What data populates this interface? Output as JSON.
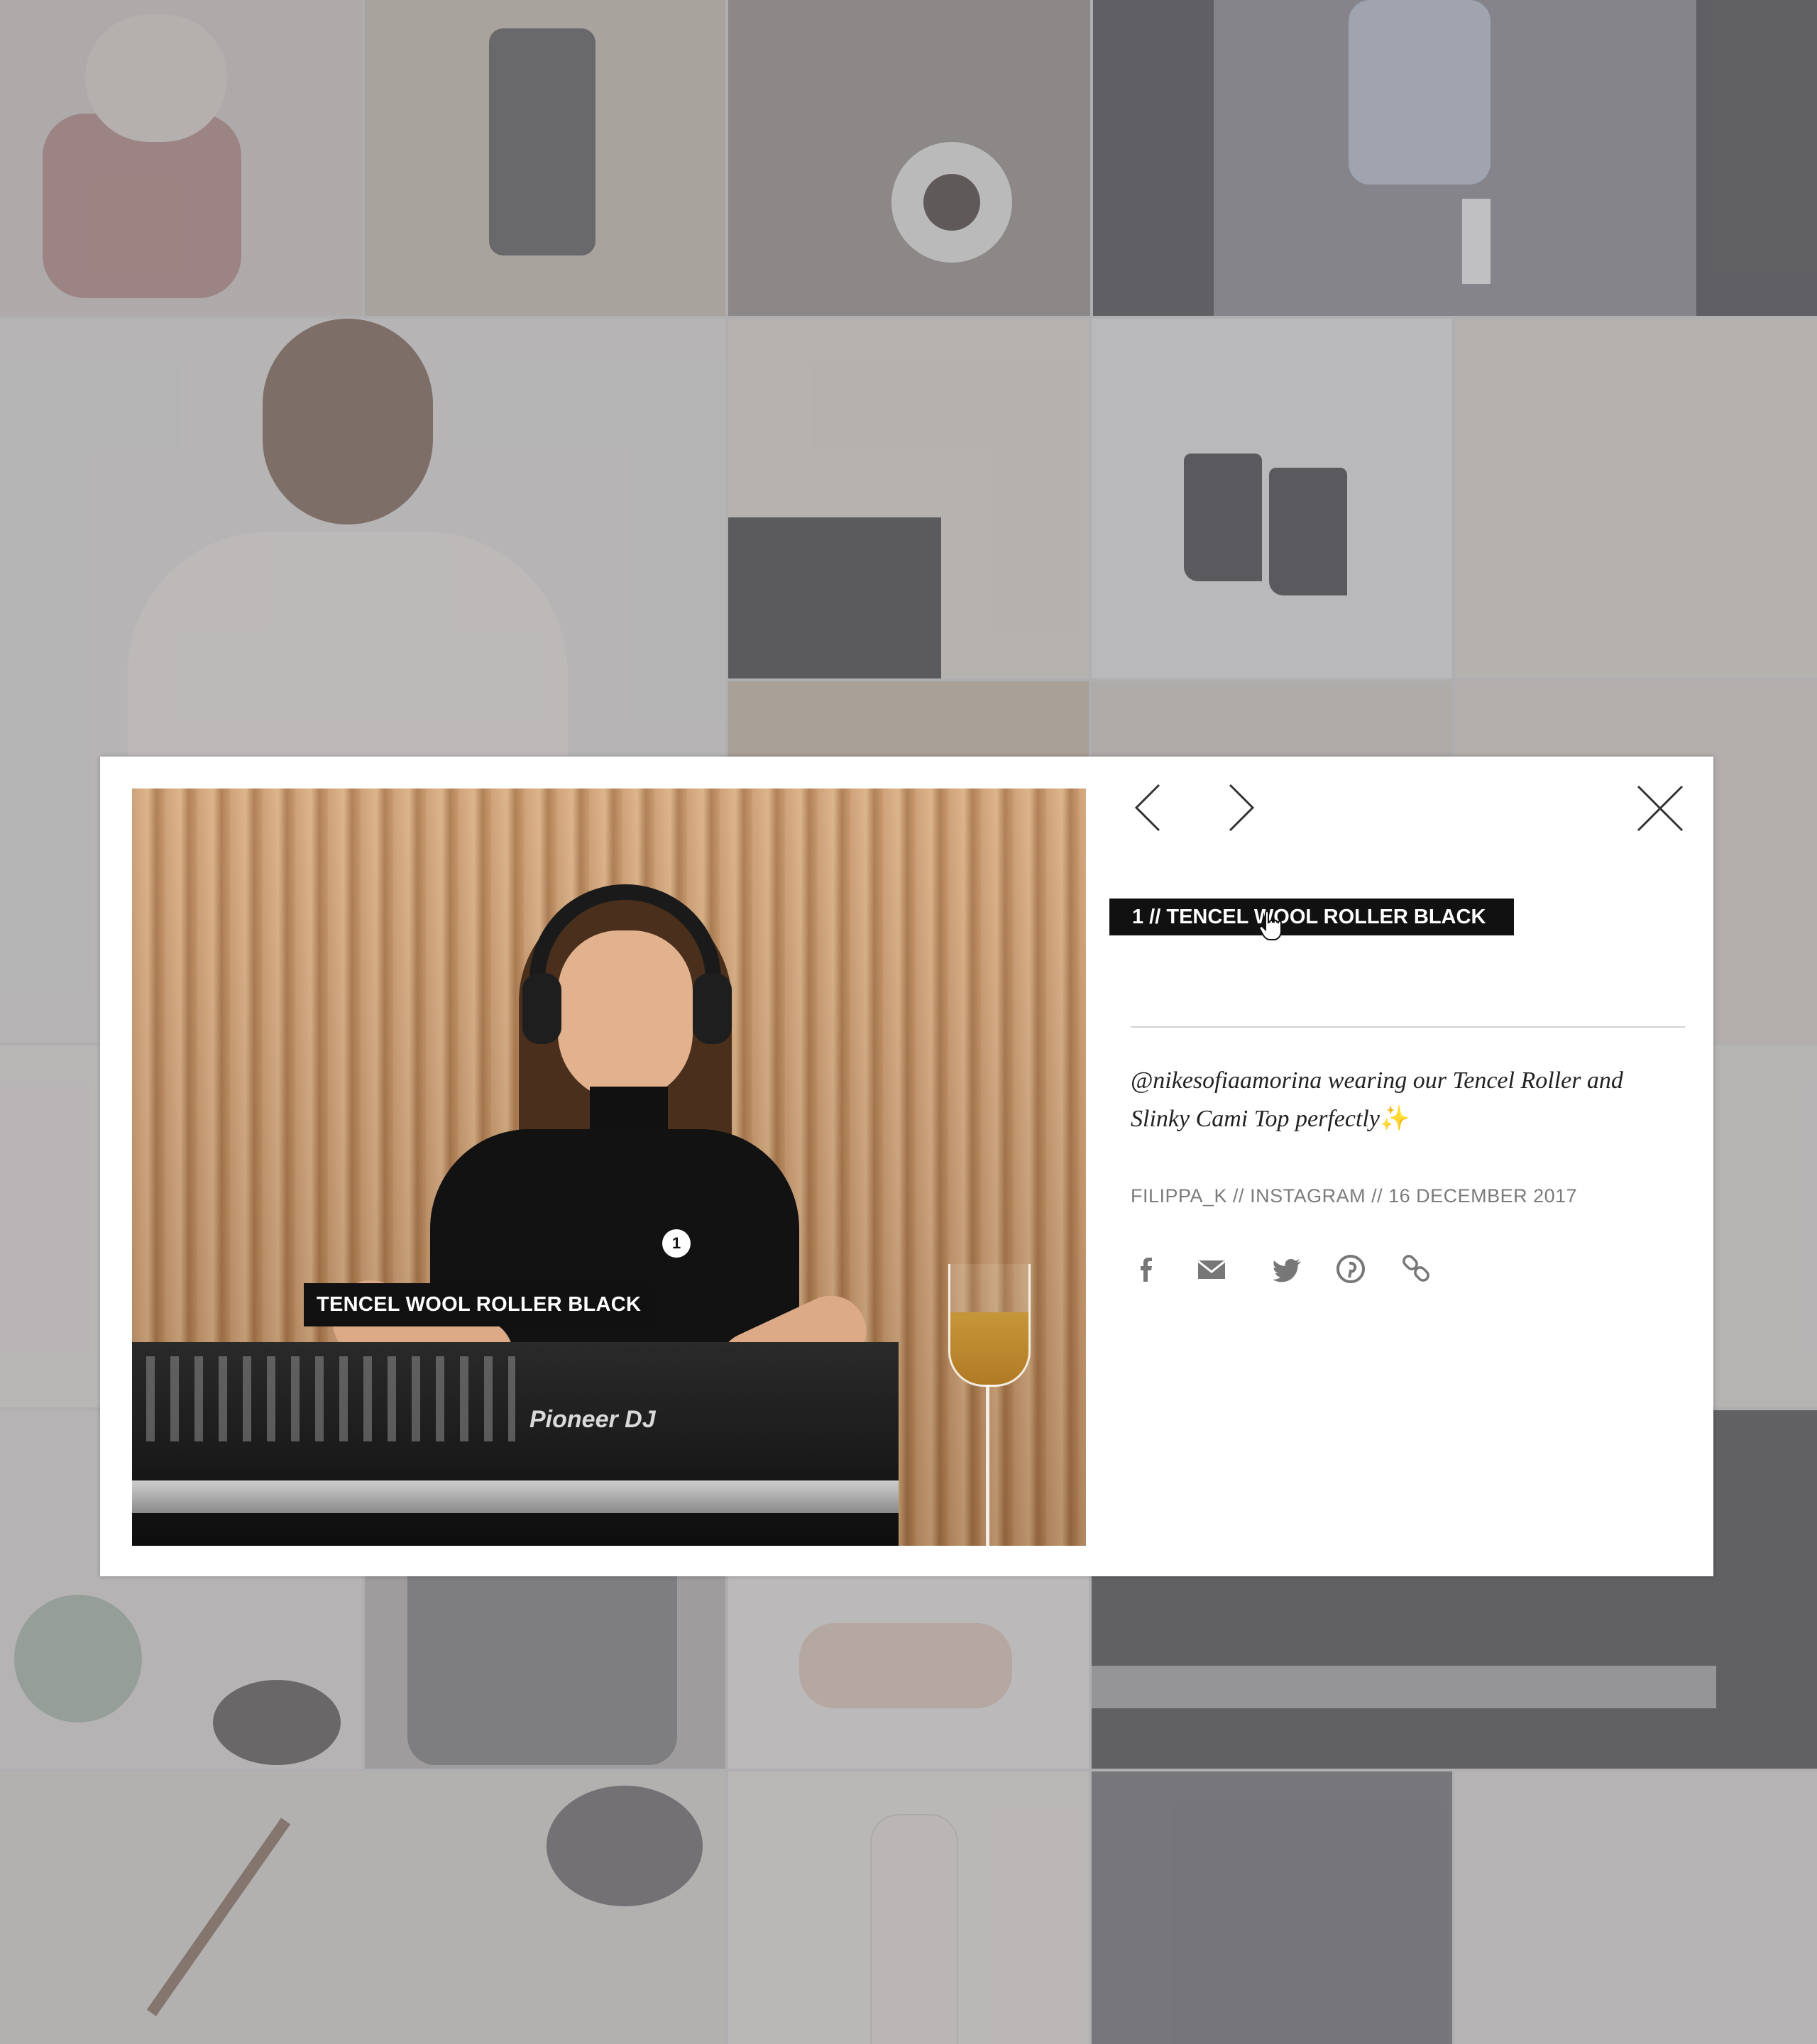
{
  "lightbox": {
    "product_tag": "1 // TENCEL WOOL ROLLER BLACK",
    "photo_tag": {
      "number": "1",
      "label": "TENCEL WOOL ROLLER BLACK"
    },
    "caption": "@nikesofiaamorina wearing our Tencel Roller and Slinky Cami Top perfectly",
    "caption_emoji": "✨",
    "meta": "FILIPPA_K // INSTAGRAM // 16 DECEMBER 2017",
    "nav": {
      "prev_icon": "chevron-left-icon",
      "next_icon": "chevron-right-icon",
      "close_icon": "close-icon"
    },
    "share_icons": [
      "facebook-icon",
      "email-icon",
      "twitter-icon",
      "pinterest-icon",
      "link-icon"
    ],
    "photo_pioneer_label": "Pioneer DJ"
  },
  "colors": {
    "overlay": "#8c8c91",
    "tag_bg": "#111111",
    "meta_text": "#7b7b7b",
    "accent_sparkle": "#f3c34a"
  }
}
